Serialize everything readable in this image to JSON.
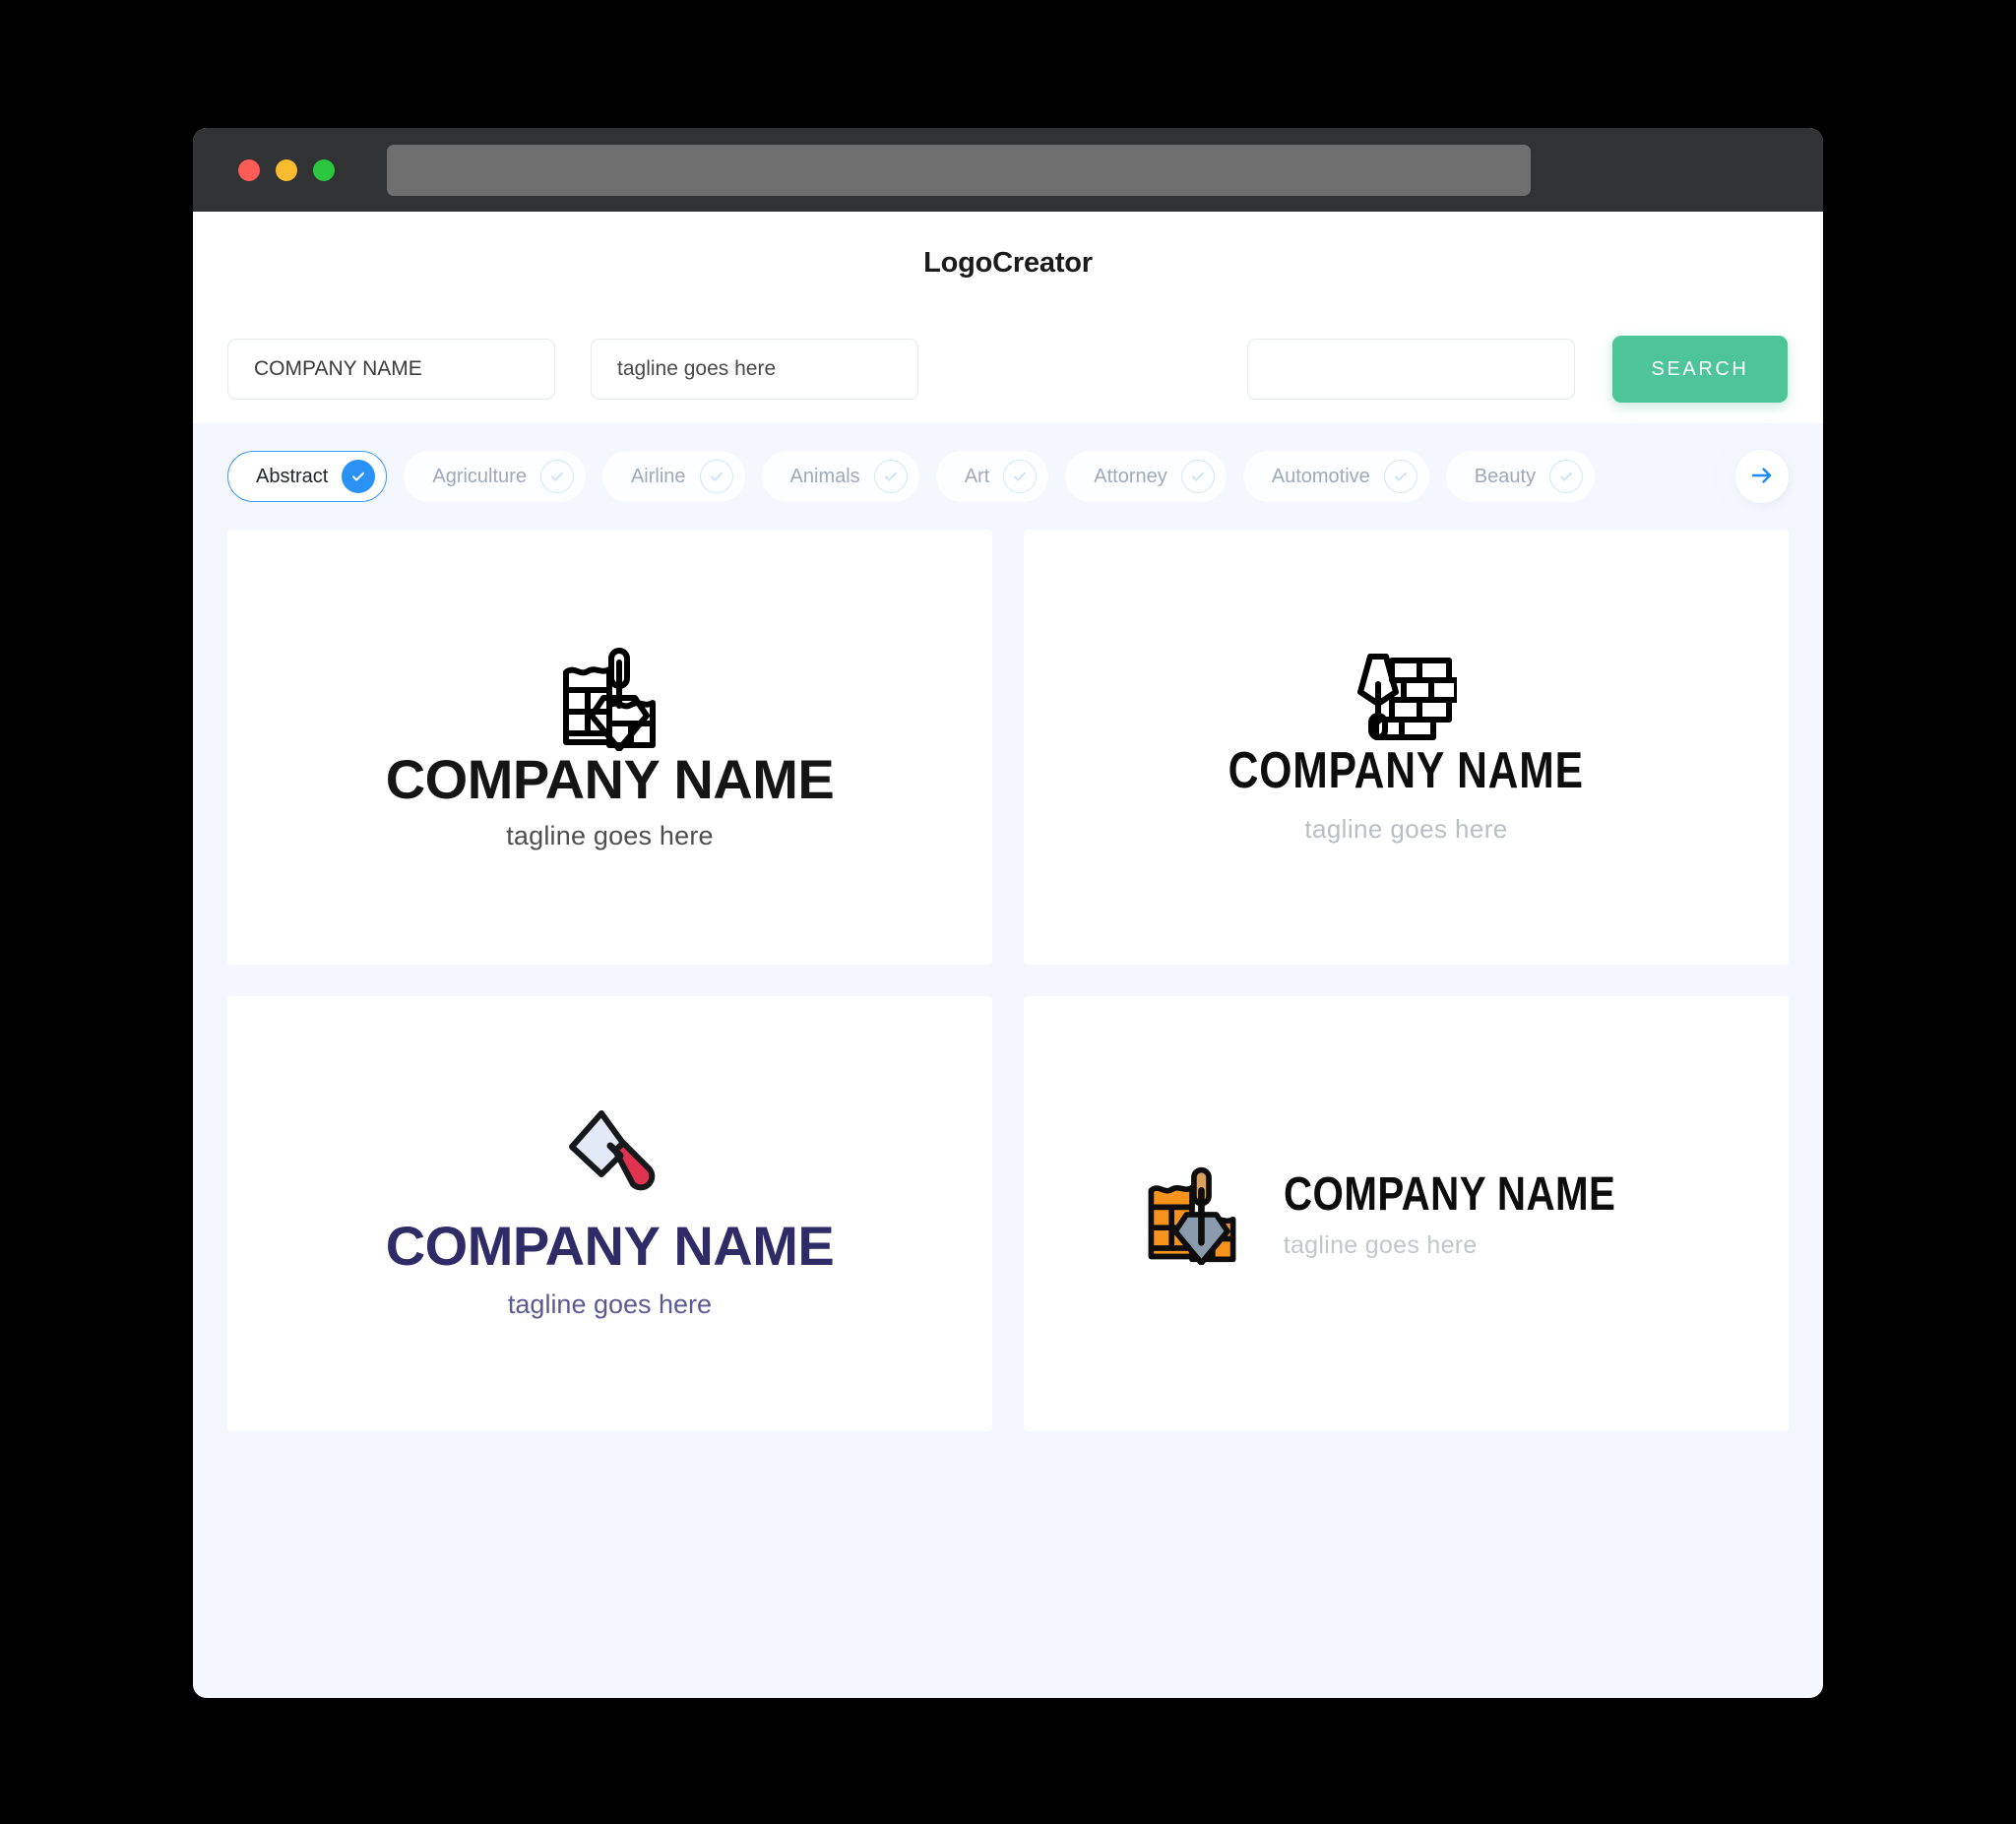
{
  "window": {
    "traffic_lights": [
      "close",
      "minimize",
      "maximize"
    ],
    "address_bar_value": ""
  },
  "header": {
    "title": "LogoCreator"
  },
  "search": {
    "company_value": "COMPANY NAME",
    "company_placeholder": "COMPANY NAME",
    "tagline_value": "tagline goes here",
    "tagline_placeholder": "tagline goes here",
    "third_value": "",
    "third_placeholder": "",
    "button_label": "SEARCH",
    "button_color": "#4ec49a"
  },
  "filters": {
    "accent_color": "#2a92f5",
    "next_icon": "arrow-right-icon",
    "items": [
      {
        "label": "Abstract",
        "selected": true
      },
      {
        "label": "Agriculture",
        "selected": false
      },
      {
        "label": "Airline",
        "selected": false
      },
      {
        "label": "Animals",
        "selected": false
      },
      {
        "label": "Art",
        "selected": false
      },
      {
        "label": "Attorney",
        "selected": false
      },
      {
        "label": "Automotive",
        "selected": false
      },
      {
        "label": "Beauty",
        "selected": false
      }
    ]
  },
  "results": {
    "cards": [
      {
        "icon": "brick-wall-trowel-outline-icon",
        "layout": "vertical",
        "name": "COMPANY NAME",
        "tagline": "tagline goes here",
        "name_color": "#151515",
        "tagline_color": "#4e4e4e"
      },
      {
        "icon": "brick-wall-trowel-left-outline-icon",
        "layout": "vertical",
        "name": "COMPANY NAME",
        "tagline": "tagline goes here",
        "name_color": "#0d0d0d",
        "tagline_color": "#b9bec4"
      },
      {
        "icon": "putty-knife-scraper-icon",
        "layout": "vertical",
        "name": "COMPANY NAME",
        "tagline": "tagline goes here",
        "name_color": "#2f2b67",
        "tagline_color": "#5c5a93"
      },
      {
        "icon": "brick-wall-trowel-color-icon",
        "layout": "horizontal",
        "name": "COMPANY NAME",
        "tagline": "tagline goes here",
        "name_color": "#0d0d0d",
        "tagline_color": "#c2c6cb"
      }
    ]
  }
}
